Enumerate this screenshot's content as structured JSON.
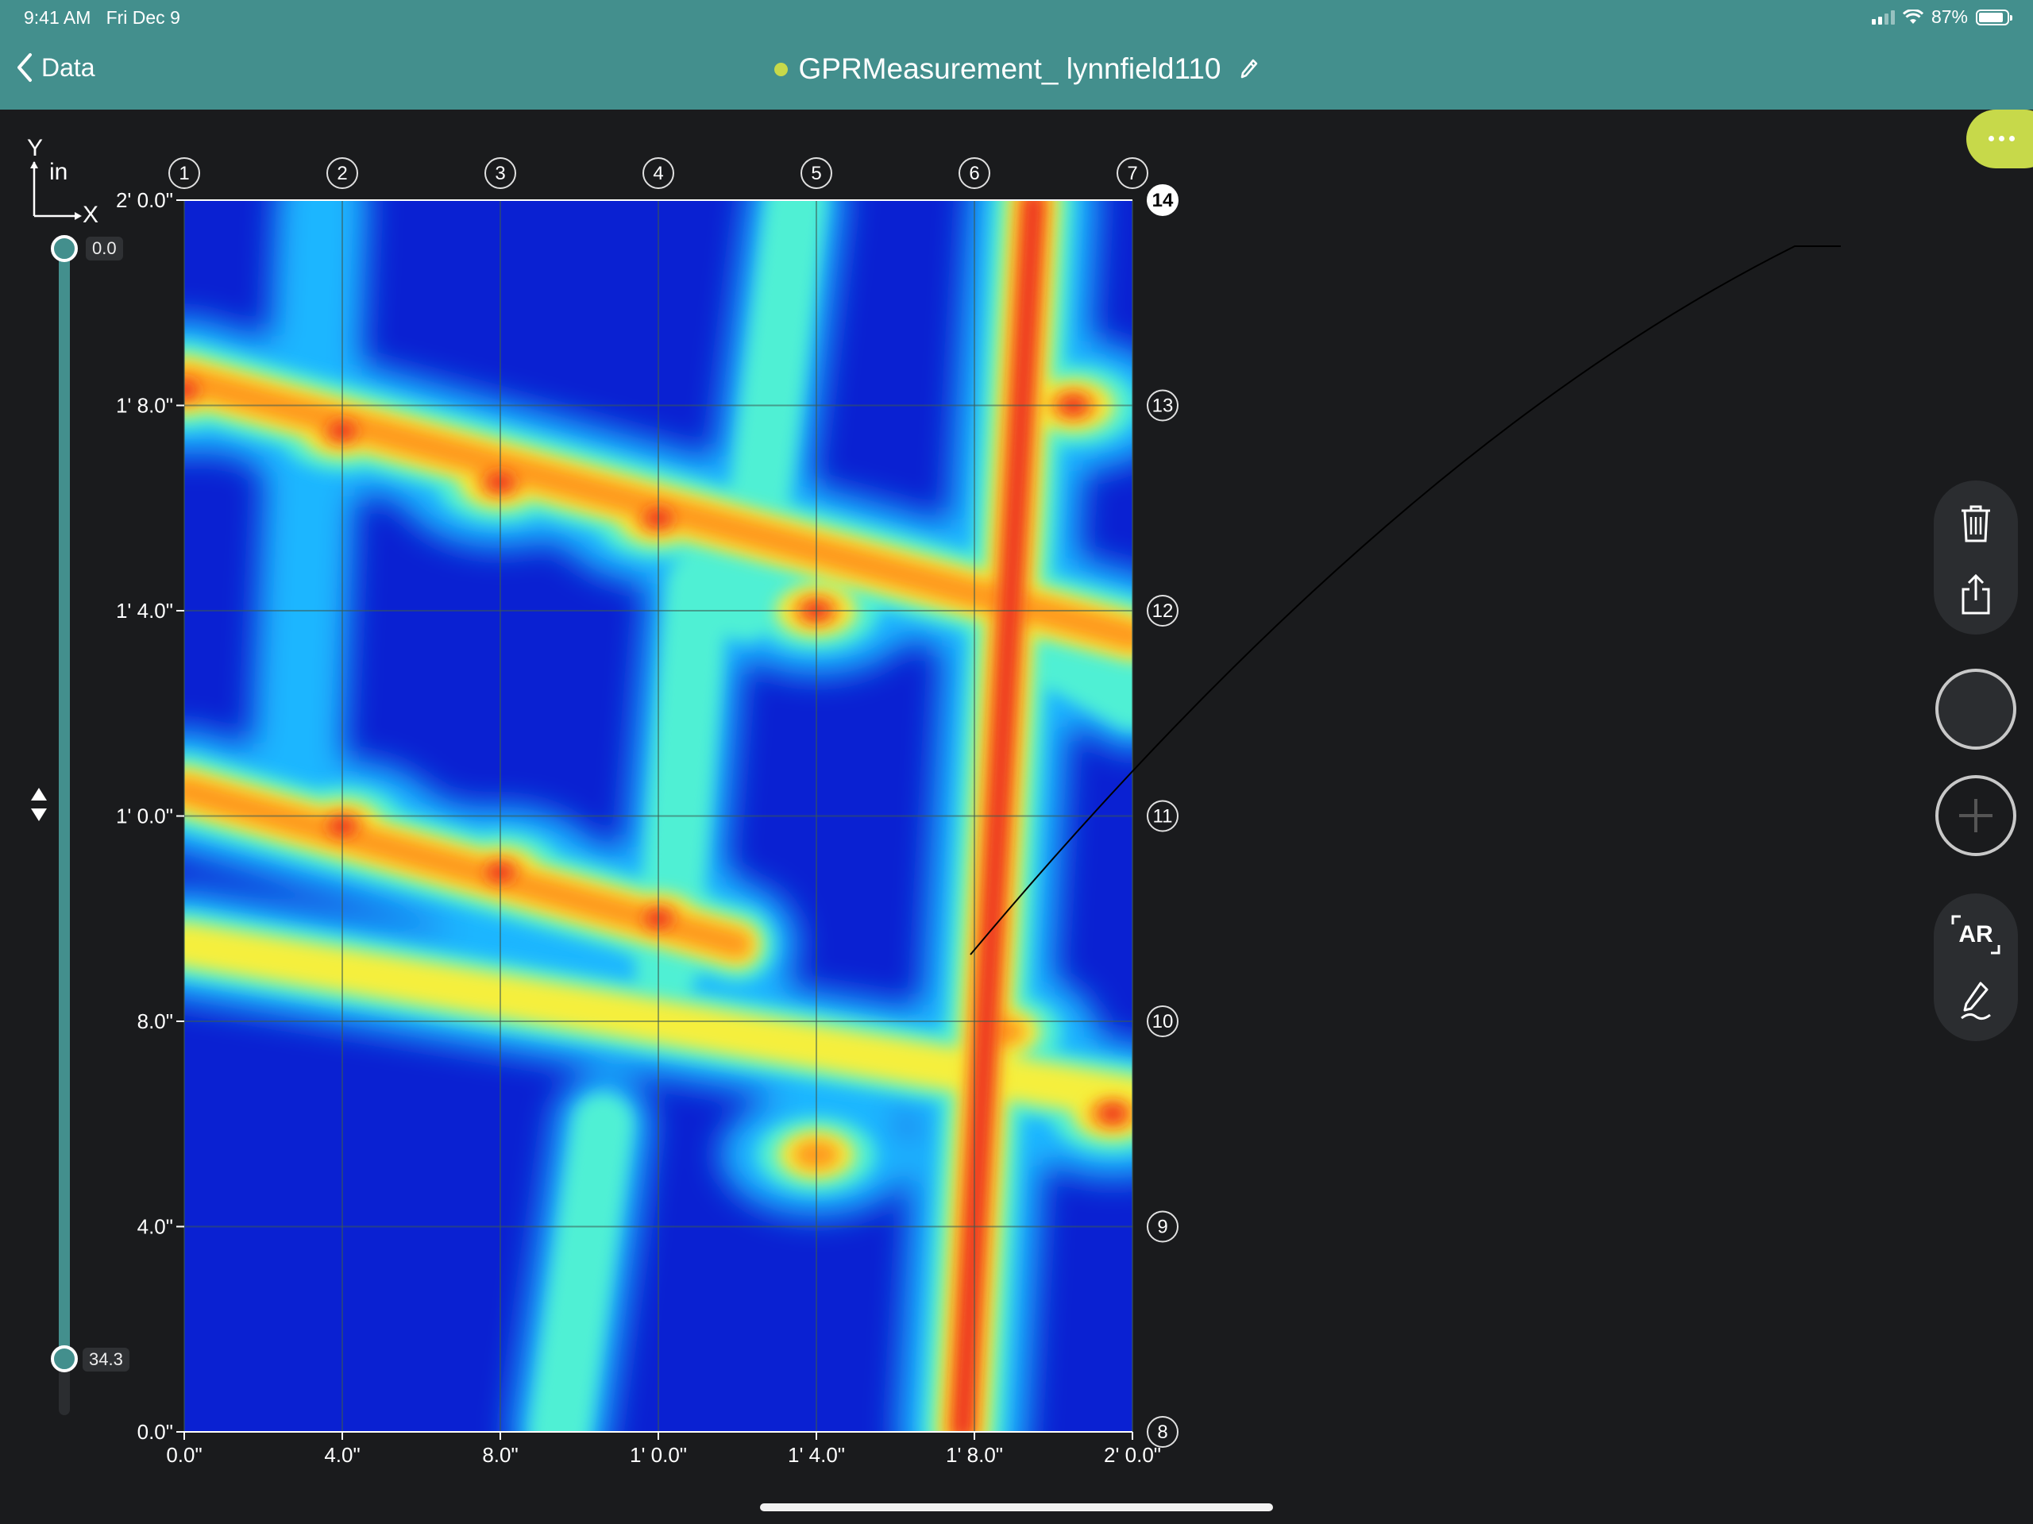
{
  "status_bar": {
    "time": "9:41 AM",
    "date": "Fri Dec 9",
    "battery": "87%",
    "battery_level": 0.87
  },
  "nav": {
    "back_label": "Data",
    "title": "GPRMeasurement_ lynnfield110",
    "status_color": "#c7d94a"
  },
  "colors": {
    "accent": "#438f8d",
    "highlight": "#c7d94a",
    "background": "#1a1b1d"
  },
  "axis_context": {
    "y": "Y",
    "unit": "in",
    "x": "X"
  },
  "depth_slider": {
    "top_value": "0.0",
    "bottom_value": "34.3"
  },
  "chart_data": {
    "type": "heatmap",
    "colormap": "jet",
    "x_ticks": [
      "0.0\"",
      "4.0\"",
      "8.0\"",
      "1' 0.0\"",
      "1' 4.0\"",
      "1' 8.0\"",
      "2' 0.0\""
    ],
    "y_ticks": [
      "0.0\"",
      "4.0\"",
      "8.0\"",
      "1' 0.0\"",
      "1' 4.0\"",
      "1' 8.0\"",
      "2' 0.0\""
    ],
    "xlim_in": [
      0,
      24
    ],
    "ylim_in": [
      0,
      24
    ],
    "grid": true,
    "x_lines": [
      {
        "label": "1",
        "x_in": 0
      },
      {
        "label": "2",
        "x_in": 4
      },
      {
        "label": "3",
        "x_in": 8
      },
      {
        "label": "4",
        "x_in": 12
      },
      {
        "label": "5",
        "x_in": 16
      },
      {
        "label": "6",
        "x_in": 20
      },
      {
        "label": "7",
        "x_in": 24
      }
    ],
    "y_lines": [
      {
        "label": "8",
        "y_in": 0
      },
      {
        "label": "9",
        "y_in": 4
      },
      {
        "label": "10",
        "y_in": 8
      },
      {
        "label": "11",
        "y_in": 12
      },
      {
        "label": "12",
        "y_in": 16
      },
      {
        "label": "13",
        "y_in": 20
      },
      {
        "label": "14",
        "y_in": 24,
        "selected": true
      }
    ],
    "features": [
      {
        "kind": "line",
        "from": [
          0,
          20.5
        ],
        "to": [
          24,
          15.5
        ],
        "intensity": 0.9
      },
      {
        "kind": "line",
        "from": [
          0,
          12.5
        ],
        "to": [
          14,
          9.5
        ],
        "intensity": 0.85
      },
      {
        "kind": "line",
        "from": [
          0,
          9.5
        ],
        "to": [
          24,
          6.5
        ],
        "intensity": 0.65
      },
      {
        "kind": "line",
        "from": [
          20.5,
          15.8
        ],
        "to": [
          24,
          14.3
        ],
        "intensity": 0.55
      },
      {
        "kind": "line",
        "from": [
          21.5,
          24
        ],
        "to": [
          19.7,
          0
        ],
        "intensity": 1.0
      },
      {
        "kind": "line",
        "from": [
          3.5,
          24
        ],
        "to": [
          2.8,
          12
        ],
        "intensity": 0.35
      },
      {
        "kind": "line",
        "from": [
          15.5,
          24
        ],
        "to": [
          14.2,
          16
        ],
        "intensity": 0.45
      },
      {
        "kind": "line",
        "from": [
          13,
          16.5
        ],
        "to": [
          12.2,
          9
        ],
        "intensity": 0.5
      },
      {
        "kind": "line",
        "from": [
          10.6,
          6
        ],
        "to": [
          9.5,
          0
        ],
        "intensity": 0.45
      },
      {
        "kind": "spot",
        "at": [
          4,
          19.5
        ],
        "intensity": 1.0
      },
      {
        "kind": "spot",
        "at": [
          8,
          18.5
        ],
        "intensity": 1.0
      },
      {
        "kind": "spot",
        "at": [
          12,
          17.8
        ],
        "intensity": 1.0
      },
      {
        "kind": "spot",
        "at": [
          0,
          20.3
        ],
        "intensity": 0.95
      },
      {
        "kind": "spot",
        "at": [
          16,
          16.0
        ],
        "intensity": 0.95
      },
      {
        "kind": "spot",
        "at": [
          22.5,
          20.0
        ],
        "intensity": 1.0
      },
      {
        "kind": "spot",
        "at": [
          4,
          11.8
        ],
        "intensity": 1.0
      },
      {
        "kind": "spot",
        "at": [
          8,
          10.9
        ],
        "intensity": 1.0
      },
      {
        "kind": "spot",
        "at": [
          12,
          10.0
        ],
        "intensity": 1.0
      },
      {
        "kind": "spot",
        "at": [
          16,
          5.4
        ],
        "intensity": 0.85
      },
      {
        "kind": "spot",
        "at": [
          23.5,
          6.2
        ],
        "intensity": 0.95
      },
      {
        "kind": "spot",
        "at": [
          20.7,
          7.8
        ],
        "intensity": 0.85
      }
    ]
  },
  "tools": {
    "more": "more-icon",
    "delete": "trash-icon",
    "share": "share-icon",
    "ar_label": "AR",
    "draw": "pencil-icon"
  }
}
